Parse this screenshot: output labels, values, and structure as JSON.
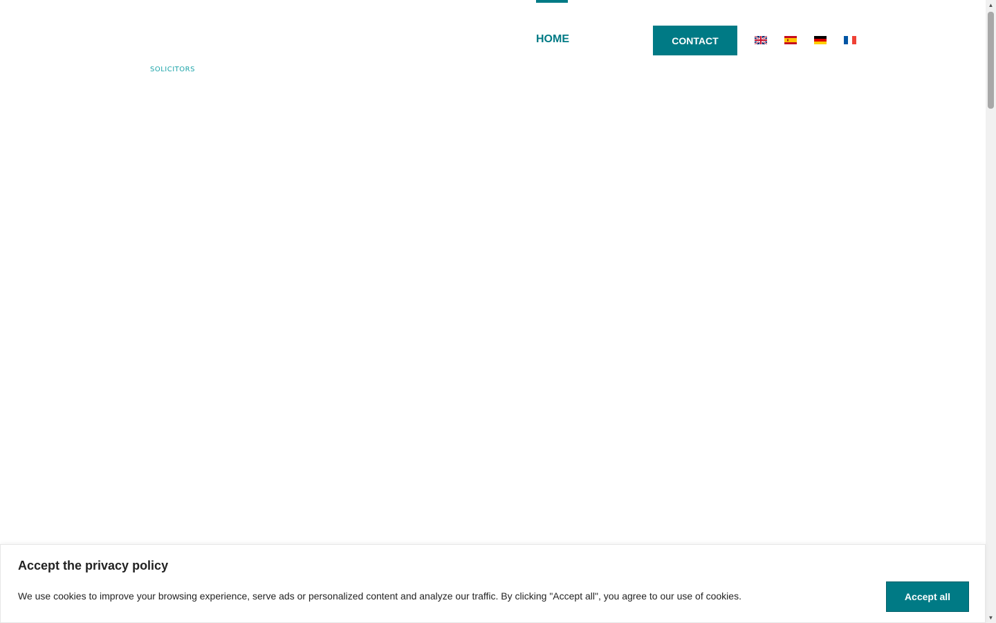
{
  "header": {
    "logo_tagline": "SOLICITORS",
    "nav": {
      "home_label": "HOME"
    },
    "contact_label": "CONTACT",
    "languages": [
      {
        "code": "en",
        "flag": "uk-flag-icon"
      },
      {
        "code": "es",
        "flag": "spain-flag-icon"
      },
      {
        "code": "de",
        "flag": "germany-flag-icon"
      },
      {
        "code": "fr",
        "flag": "france-flag-icon"
      }
    ]
  },
  "cookie_banner": {
    "title": "Accept the privacy policy",
    "text": "We use cookies to improve your browsing experience, serve ads or personalized content and analyze our traffic. By clicking \"Accept all\", you agree to our use of cookies.",
    "accept_label": "Accept all"
  },
  "colors": {
    "accent": "#007a85",
    "tagline": "#1aa3a8"
  }
}
